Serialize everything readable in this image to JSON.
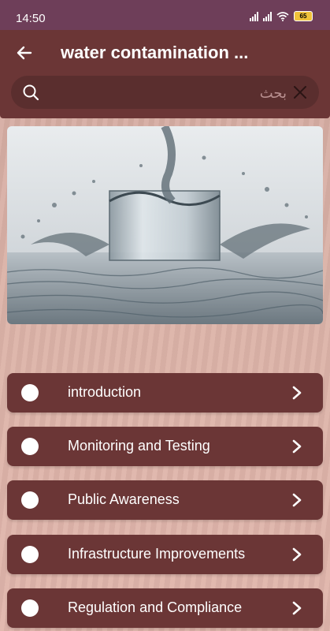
{
  "status_bar": {
    "time": "14:50",
    "battery": "65"
  },
  "app_bar": {
    "title": "water contamination ..."
  },
  "search": {
    "placeholder": "بحث"
  },
  "hero": {
    "image": "water-splash-glass"
  },
  "menu": [
    {
      "label": "introduction"
    },
    {
      "label": "Monitoring and Testing"
    },
    {
      "label": "Public Awareness"
    },
    {
      "label": "Infrastructure Improvements"
    },
    {
      "label": "Regulation and Compliance"
    }
  ],
  "colors": {
    "status_bar": "#6e3e59",
    "app_bar": "#6b3636",
    "item_bg": "#6b3636",
    "background": "#d9aea4"
  }
}
